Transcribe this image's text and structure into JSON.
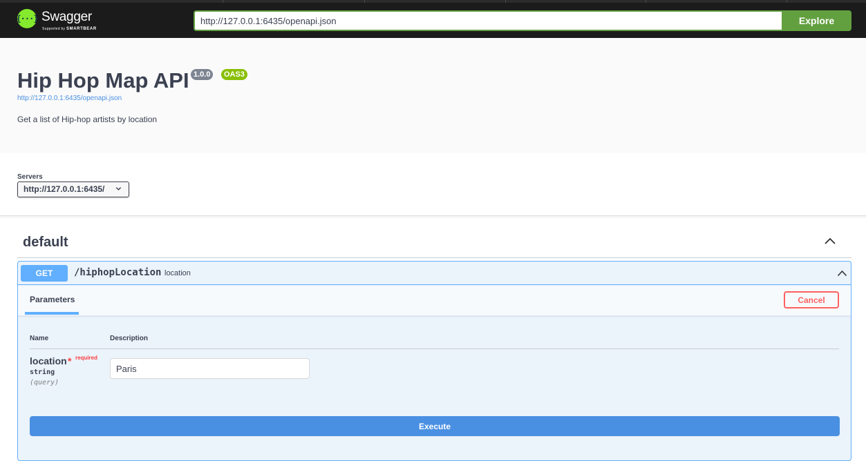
{
  "topbar": {
    "brand": "Swagger",
    "supported_prefix": "Supported by",
    "supported_brand": "SMARTBEAR",
    "logo_glyph": "{···}",
    "url_value": "http://127.0.0.1:6435/openapi.json",
    "explore_label": "Explore",
    "accent": "#62a03f"
  },
  "info": {
    "title": "Hip Hop Map API",
    "version": "1.0.0",
    "oas_badge": "OAS3",
    "spec_link": "http://127.0.0.1:6435/openapi.json",
    "description": "Get a list of Hip-hop artists by location"
  },
  "servers": {
    "label": "Servers",
    "selected": "http://127.0.0.1:6435/"
  },
  "tag": {
    "name": "default",
    "expanded": true
  },
  "operation": {
    "method": "GET",
    "path": "/hiphopLocation",
    "summary": "location",
    "method_color": "#61affe",
    "tab_label": "Parameters",
    "cancel_label": "Cancel",
    "columns": {
      "name": "Name",
      "description": "Description"
    },
    "parameters": [
      {
        "name": "location",
        "required_mark": "*",
        "required_label": "required",
        "type": "string",
        "in": "(query)",
        "value": "Paris"
      }
    ],
    "execute_label": "Execute",
    "execute_color": "#4990e2"
  }
}
